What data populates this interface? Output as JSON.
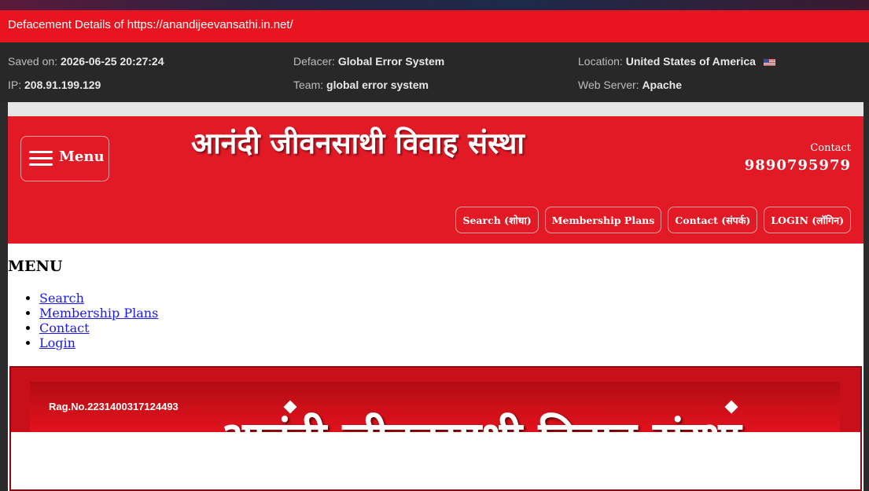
{
  "banner": {
    "text": "Defacement Details of https://anandijeevansathi.in.net/"
  },
  "info": {
    "saved_label": "Saved on:",
    "saved_value": "2026-06-25 20:27:24",
    "defacer_label": "Defacer:",
    "defacer_value": "Global Error System",
    "location_label": "Location:",
    "location_value": "United States of America",
    "ip_label": "IP:",
    "ip_value": "208.91.199.129",
    "team_label": "Team:",
    "team_value": "global error system",
    "server_label": "Web Server:",
    "server_value": "Apache",
    "flag_icon": "us-flag-icon"
  },
  "site": {
    "menu_button": "Menu",
    "title": "आनंदी जीवनसाथी विवाह संस्था",
    "contact_label": "Contact",
    "contact_phone": "9890795979",
    "nav": [
      {
        "label": "Search (शोधा)"
      },
      {
        "label": "Membership Plans"
      },
      {
        "label": "Contact (संपर्क)"
      },
      {
        "label": "LOGIN (लॉगिन)"
      }
    ],
    "menu_heading": "MENU",
    "menu_links": [
      {
        "label": "Search"
      },
      {
        "label": "Membership Plans"
      },
      {
        "label": "Contact"
      },
      {
        "label": "Login"
      }
    ],
    "hero_reg": "Rag.No.2231400317124493",
    "hero_title": "आनंदी जीवनसाथी विवाह संस्था"
  },
  "colors": {
    "banner_red": "#e8141f",
    "header_red": "#e11a26",
    "info_bg": "#282828",
    "link_blue": "#1a1aee"
  }
}
